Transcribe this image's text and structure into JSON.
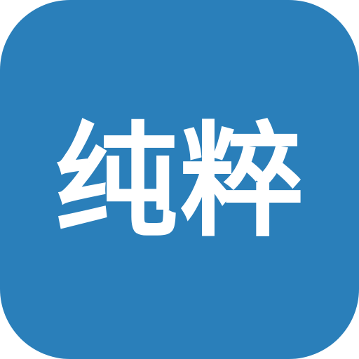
{
  "app_icon": {
    "label": "纯粹",
    "background_color": "#2a7fba",
    "text_color": "#ffffff"
  }
}
